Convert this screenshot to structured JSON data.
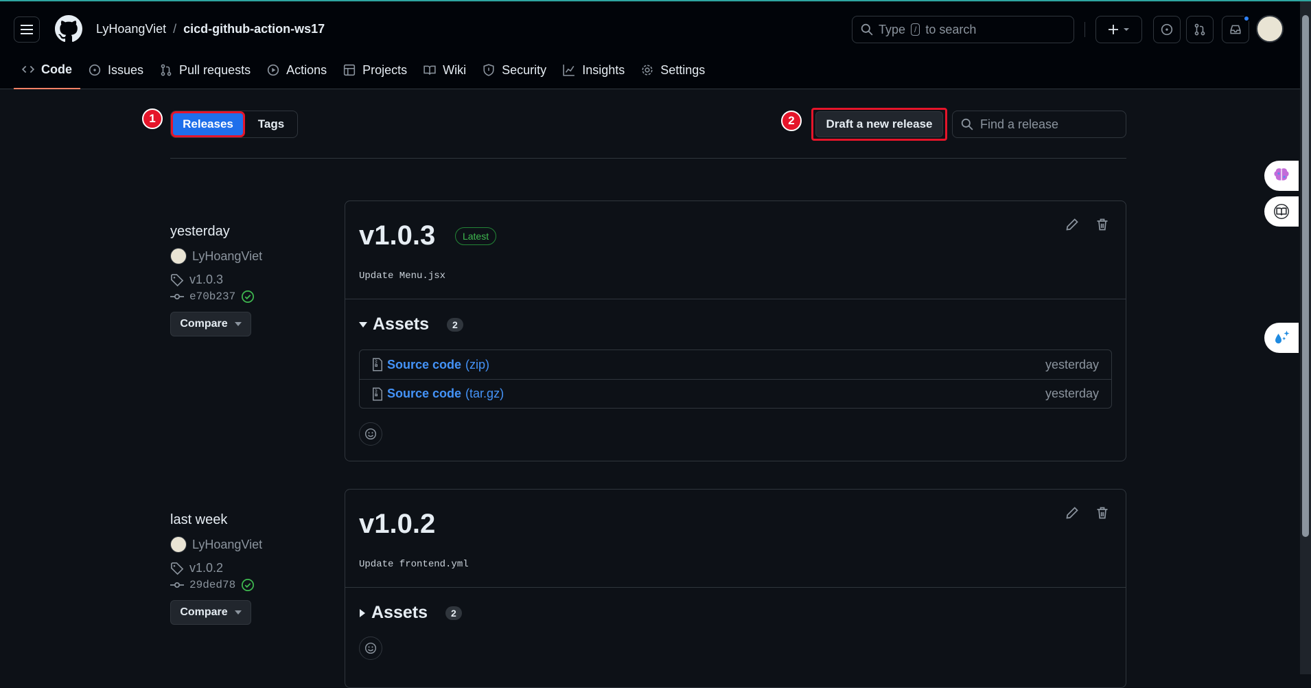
{
  "header": {
    "owner": "LyHoangViet",
    "separator": "/",
    "repo": "cicd-github-action-ws17",
    "search_prefix": "Type",
    "search_key": "/",
    "search_suffix": "to search"
  },
  "nav": {
    "code": "Code",
    "issues": "Issues",
    "pulls": "Pull requests",
    "actions": "Actions",
    "projects": "Projects",
    "wiki": "Wiki",
    "security": "Security",
    "insights": "Insights",
    "settings": "Settings"
  },
  "toolbar": {
    "releases": "Releases",
    "tags": "Tags",
    "draft": "Draft a new release",
    "find_placeholder": "Find a release",
    "marker1": "1",
    "marker2": "2"
  },
  "releases": [
    {
      "when": "yesterday",
      "author": "LyHoangViet",
      "tag": "v1.0.3",
      "commit": "e70b237",
      "compare": "Compare",
      "version": "v1.0.3",
      "latest": "Latest",
      "message": "Update Menu.jsx",
      "assets_label": "Assets",
      "assets_count": "2",
      "assets": [
        {
          "name": "Source code",
          "ext": "(zip)",
          "time": "yesterday"
        },
        {
          "name": "Source code",
          "ext": "(tar.gz)",
          "time": "yesterday"
        }
      ]
    },
    {
      "when": "last week",
      "author": "LyHoangViet",
      "tag": "v1.0.2",
      "commit": "29ded78",
      "compare": "Compare",
      "version": "v1.0.2",
      "message": "Update frontend.yml",
      "assets_label": "Assets",
      "assets_count": "2"
    }
  ]
}
